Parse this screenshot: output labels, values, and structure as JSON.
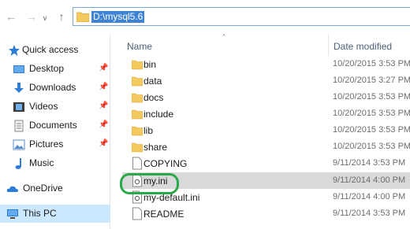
{
  "address_bar": {
    "path": "D:\\mysql5.6",
    "icons": [
      "back-arrow-icon",
      "forward-arrow-icon",
      "recent-locations-chevron-icon",
      "up-arrow-icon",
      "folder-icon"
    ]
  },
  "columns": {
    "name": "Name",
    "date_modified": "Date modified"
  },
  "navigation": [
    {
      "label": "Quick access",
      "icon": "star-icon",
      "pinned": false
    },
    {
      "label": "Desktop",
      "icon": "desktop-icon",
      "pinned": true
    },
    {
      "label": "Downloads",
      "icon": "download-icon",
      "pinned": true
    },
    {
      "label": "Videos",
      "icon": "video-icon",
      "pinned": true
    },
    {
      "label": "Documents",
      "icon": "documents-icon",
      "pinned": true
    },
    {
      "label": "Pictures",
      "icon": "pictures-icon",
      "pinned": true
    },
    {
      "label": "Music",
      "icon": "music-icon",
      "pinned": false
    },
    {
      "label": "OneDrive",
      "icon": "cloud-icon",
      "pinned": false
    },
    {
      "label": "This PC",
      "icon": "computer-icon",
      "pinned": false,
      "selected": true
    }
  ],
  "files": [
    {
      "name": "bin",
      "type": "folder",
      "date": "10/20/2015 3:53 PM"
    },
    {
      "name": "data",
      "type": "folder",
      "date": "10/20/2015 3:27 PM"
    },
    {
      "name": "docs",
      "type": "folder",
      "date": "10/20/2015 3:53 PM"
    },
    {
      "name": "include",
      "type": "folder",
      "date": "10/20/2015 3:53 PM"
    },
    {
      "name": "lib",
      "type": "folder",
      "date": "10/20/2015 3:53 PM"
    },
    {
      "name": "share",
      "type": "folder",
      "date": "10/20/2015 3:53 PM"
    },
    {
      "name": "COPYING",
      "type": "file",
      "date": "9/11/2014 3:53 PM"
    },
    {
      "name": "my.ini",
      "type": "ini",
      "date": "9/11/2014 4:00 PM",
      "selected": true,
      "highlighted": true
    },
    {
      "name": "my-default.ini",
      "type": "ini",
      "date": "9/11/2014 4:00 PM"
    },
    {
      "name": "README",
      "type": "file",
      "date": "9/11/2014 3:53 PM"
    }
  ],
  "colors": {
    "address_highlight": "#3f83d4",
    "selection": "#d9d9d9",
    "nav_selection": "#cce8ff",
    "annotation_oval": "#2aa84a",
    "folder": "#f4c95d"
  }
}
